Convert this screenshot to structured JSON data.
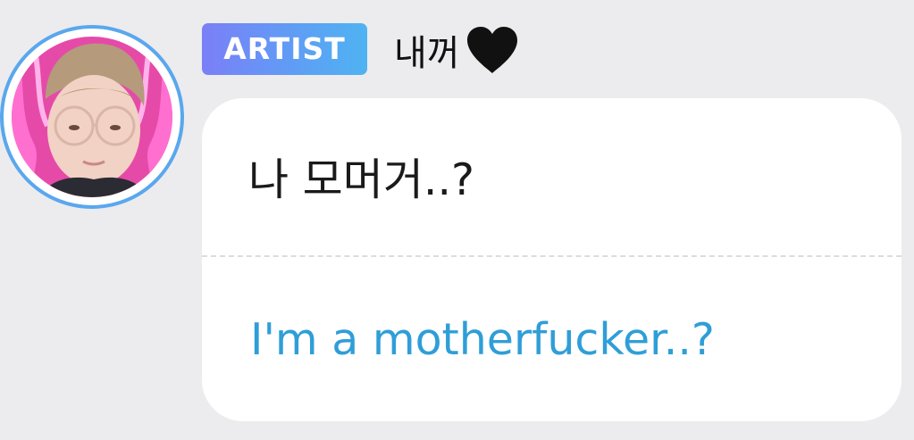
{
  "post": {
    "badge": "ARTIST",
    "nickname": "내꺼",
    "nickname_icon": "black-heart-icon",
    "message": "나 모머거..?",
    "translation": "I'm a motherfucker..?"
  },
  "colors": {
    "badge_gradient_start": "#7b7ff7",
    "badge_gradient_end": "#4fb3f2",
    "avatar_ring": "#5aa7ee",
    "translation_text": "#2f9ed8",
    "background": "#ececee"
  }
}
